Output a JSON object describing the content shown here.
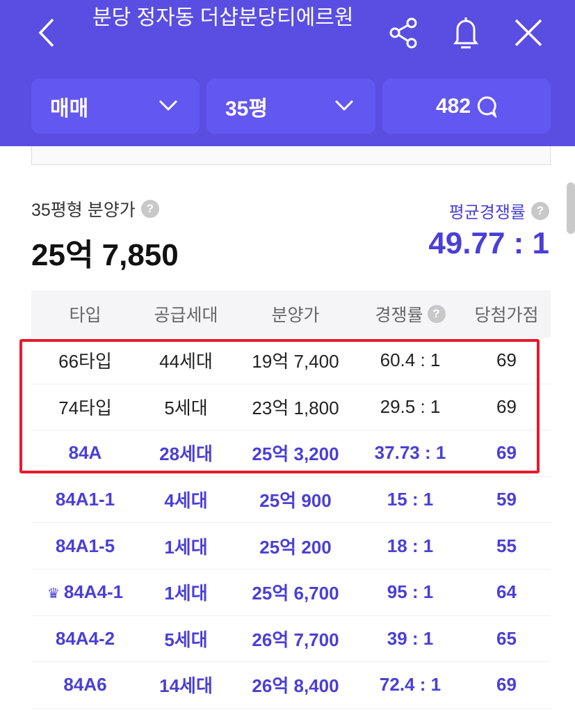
{
  "header": {
    "title": "분당 정자동 더샵분당티에르원",
    "deal_type": "매매",
    "size": "35평",
    "comment_count": "482"
  },
  "summary": {
    "label": "35평형 분양가",
    "price": "25억 7,850",
    "avg_label": "평균경쟁률",
    "avg_rate": "49.77 : 1"
  },
  "table": {
    "columns": [
      "타입",
      "공급세대",
      "분양가",
      "경쟁률",
      "당첨가점"
    ],
    "rows": [
      {
        "type": "66타입",
        "units": "44세대",
        "price": "19억 7,400",
        "rate": "60.4 : 1",
        "score": "69",
        "style": "dark"
      },
      {
        "type": "74타입",
        "units": "5세대",
        "price": "23억 1,800",
        "rate": "29.5 : 1",
        "score": "69",
        "style": "dark"
      },
      {
        "type": "84A",
        "units": "28세대",
        "price": "25억 3,200",
        "rate": "37.73 : 1",
        "score": "69",
        "style": "acc"
      },
      {
        "type": "84A1-1",
        "units": "4세대",
        "price": "25억 900",
        "rate": "15 : 1",
        "score": "59",
        "style": "acc"
      },
      {
        "type": "84A1-5",
        "units": "1세대",
        "price": "25억 200",
        "rate": "18 : 1",
        "score": "55",
        "style": "acc"
      },
      {
        "type": "84A4-1",
        "units": "1세대",
        "price": "25억 6,700",
        "rate": "95 : 1",
        "score": "64",
        "style": "acc",
        "crown": true
      },
      {
        "type": "84A4-2",
        "units": "5세대",
        "price": "26억 7,700",
        "rate": "39 : 1",
        "score": "65",
        "style": "acc"
      },
      {
        "type": "84A6",
        "units": "14세대",
        "price": "26억 8,400",
        "rate": "72.4 : 1",
        "score": "69",
        "style": "acc"
      }
    ]
  },
  "colors": {
    "header": "#5a4ee2",
    "accent": "#4a3fd6",
    "highlight": "#e8192c"
  }
}
